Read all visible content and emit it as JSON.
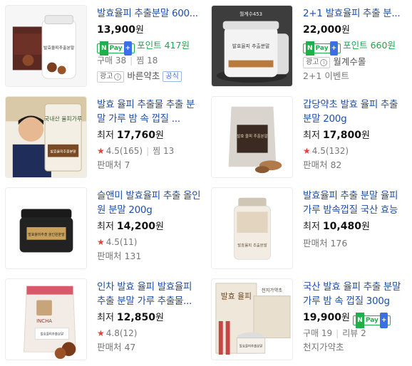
{
  "products": [
    {
      "title": "발효율피 추출분말 600...",
      "price": "13,900",
      "price_unit": "원",
      "npay_text": "포인트 417원",
      "meta": [
        "구매 38",
        "찜 18"
      ],
      "ad_label": "광고",
      "seller": "바른약초",
      "official_label": "공식",
      "thumb_text": "발효율피추출분말"
    },
    {
      "title": "2+1 발효율피 추출 분...",
      "price": "22,000",
      "price_unit": "원",
      "npay_text": "포인트 660원",
      "ad_label": "광고",
      "seller": "월계수몰",
      "promo": "2+1 이벤트",
      "thumb_text": "발효율피 추출분말",
      "thumb_top_text": "월계수453"
    },
    {
      "title": "발효 율피 추출물 추출 분말 가루 밤 속 껍질 ...",
      "price_prefix": "최저",
      "price": "17,760",
      "price_unit": "원",
      "rating": "4.5(165)",
      "extra": "찜 13",
      "sellers": "판매처 7",
      "thumb_text": "국내산 율피가루",
      "thumb_label": "발효율피추출분말"
    },
    {
      "title": "갑당약초 발효 율피 추출 분말 200g",
      "price_prefix": "최저",
      "price": "17,800",
      "price_unit": "원",
      "rating": "4.5(132)",
      "sellers": "판매처 82",
      "thumb_text": "발효 율피 추출분말"
    },
    {
      "title": "슬앤미 발효율피 추출 올인원 분말 200g",
      "price_prefix": "최저",
      "price": "14,200",
      "price_unit": "원",
      "rating": "4.5(11)",
      "sellers": "판매처 131",
      "thumb_text": "발효율피추출 올인원분말"
    },
    {
      "title": "발효율피 추출 분말 율피 가루 밤속껍질 국산 효능",
      "price_prefix": "최저",
      "price": "10,480",
      "price_unit": "원",
      "sellers": "판매처 176",
      "thumb_text": "발효율피 추출분말"
    },
    {
      "title": "인차 발효 율피 발효율피 추출 분말 가루 추출물...",
      "price_prefix": "최저",
      "price": "12,850",
      "price_unit": "원",
      "rating": "4.8(12)",
      "sellers": "판매처 47",
      "thumb_text": "INCHA",
      "thumb_label": "발효율피추출분말"
    },
    {
      "title": "국산 발효 율피 추출 분말 가루 밤 속 껍질 300g",
      "price": "19,900",
      "price_unit": "원",
      "meta": [
        "구매 19",
        "리뷰 2"
      ],
      "seller": "천지가약초",
      "thumb_text": "발효 율피",
      "thumb_brand": "천지가약초",
      "thumb_label": "발효율피추출분말"
    }
  ],
  "npay_logo": {
    "n": "N",
    "pay": "Pay",
    "plus": "+"
  },
  "colors": {
    "title": "#1f4ea8",
    "npay": "#20b04b",
    "star": "#e8413b"
  }
}
